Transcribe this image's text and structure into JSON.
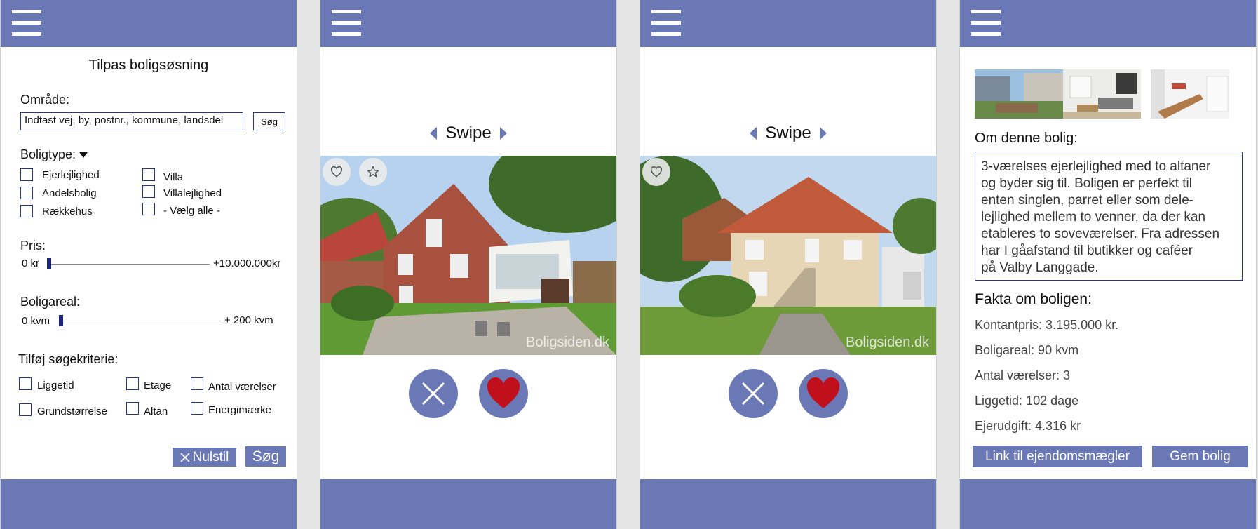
{
  "colors": {
    "accent": "#6a78b6",
    "border": "#283593",
    "heart": "#c0101c"
  },
  "icons": [
    "hamburger-menu-icon",
    "heart-icon",
    "star-icon",
    "close-x-icon",
    "triangle-left-icon",
    "triangle-right-icon"
  ],
  "screen1": {
    "title": "Tilpas boligsøsning",
    "area_label": "Område:",
    "area_placeholder": "Indtast vej, by, postnr., kommune, landsdel",
    "search_small": "Søg",
    "type_label": "Boligtype:",
    "types": [
      "Ejerlejlighed",
      "Andelsbolig",
      "Rækkehus",
      "Villa",
      "Villalejlighed",
      "- Vælg alle -"
    ],
    "price_label": "Pris:",
    "price_min": "0 kr",
    "price_max": "+10.000.000kr",
    "area_size_label": "Boligareal:",
    "size_min": "0 kvm",
    "size_max": "+ 200 kvm",
    "criteria_label": "Tilføj søgekriterie:",
    "criteria": [
      "Liggetid",
      "Etage",
      "Antal værelser",
      "Grundstørrelse",
      "Altan",
      "Energimærke"
    ],
    "reset_label": "Nulstil",
    "search_label": "Søg"
  },
  "screen2": {
    "swipe_label": "Swipe",
    "watermark": "Boligsiden.dk"
  },
  "screen3": {
    "swipe_label": "Swipe",
    "watermark": "Boligsiden.dk"
  },
  "screen4": {
    "about_heading": "Om denne bolig:",
    "about_lines": [
      "3-værelses ejerlejlighed med to altaner",
      "og byder sig til. Boligen er perfekt til",
      "enten singlen, parret eller som dele-",
      "lejlighed mellem to venner, da der kan",
      "etableres to soveværelser. Fra adressen",
      "har I gåafstand til butikker og caféer",
      "på Valby Langgade."
    ],
    "facts_heading": "Fakta om boligen:",
    "facts": [
      "Kontantpris: 3.195.000 kr.",
      "Boligareal:  90 kvm",
      "Antal værelser: 3",
      "Liggetid: 102 dage",
      "Ejerudgift: 4.316 kr"
    ],
    "link_button": "Link til ejendomsmægler",
    "save_button": "Gem bolig"
  }
}
